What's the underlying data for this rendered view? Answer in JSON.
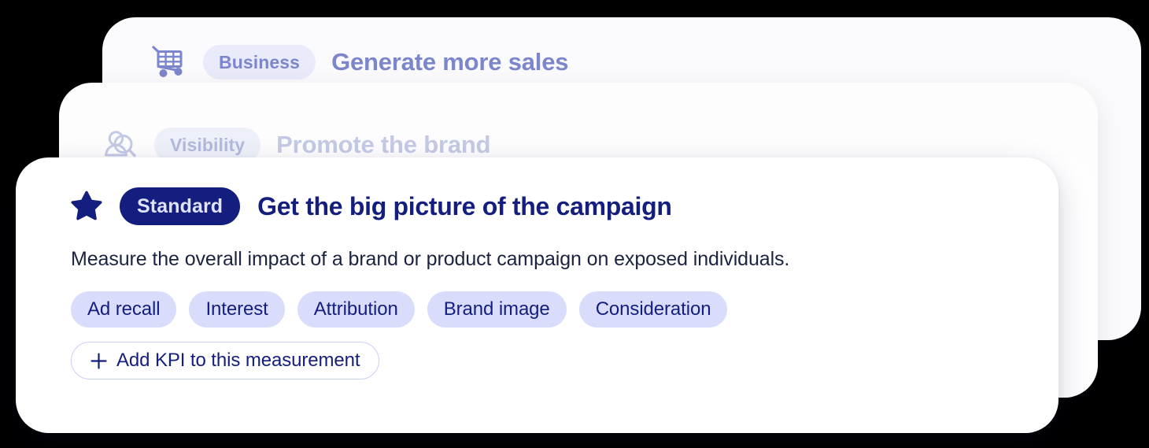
{
  "colors": {
    "navy": "#141e7e",
    "periwinkle": "#7c86cc",
    "chip_soft_bg": "#e9ebfa",
    "kpi_chip_bg": "#d9ddfb",
    "faded_text": "#c4c9e6",
    "card_bg": "#ffffff",
    "page_bg": "#000000"
  },
  "cards": {
    "back": {
      "icon": "shopping-cart-icon",
      "chip_label": "Business",
      "title": "Generate more sales"
    },
    "middle": {
      "icon": "person-magnifier-icon",
      "chip_label": "Visibility",
      "title": "Promote the brand"
    },
    "front": {
      "icon": "star-icon",
      "badge_label": "Standard",
      "title": "Get the big picture of the campaign",
      "description": "Measure the overall impact of a brand or product campaign on exposed individuals.",
      "kpis": [
        "Ad recall",
        "Interest",
        "Attribution",
        "Brand image",
        "Consideration"
      ],
      "add_kpi_label": "Add KPI to this measurement",
      "add_kpi_icon": "plus-icon"
    }
  }
}
